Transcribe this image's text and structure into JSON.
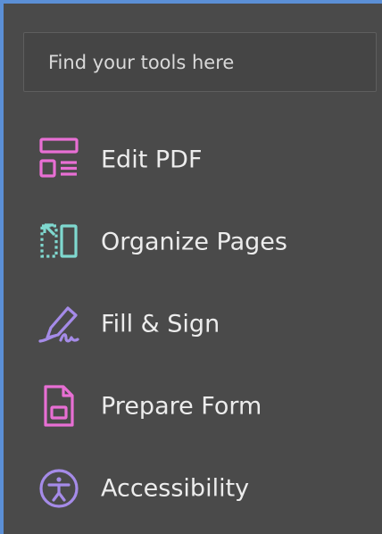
{
  "search": {
    "placeholder": "Find your tools here"
  },
  "tools": [
    {
      "label": "Edit PDF",
      "icon": "edit-pdf-icon",
      "color": "#e86fd4"
    },
    {
      "label": "Organize Pages",
      "icon": "organize-pages-icon",
      "color": "#7fd8cf"
    },
    {
      "label": "Fill & Sign",
      "icon": "fill-sign-icon",
      "color": "#a58be8"
    },
    {
      "label": "Prepare Form",
      "icon": "prepare-form-icon",
      "color": "#e86fd4"
    },
    {
      "label": "Accessibility",
      "icon": "accessibility-icon",
      "color": "#a58be8"
    }
  ],
  "colors": {
    "panel_background": "#4a4a4a",
    "panel_border": "#5b8fd6",
    "text": "#ececec"
  }
}
